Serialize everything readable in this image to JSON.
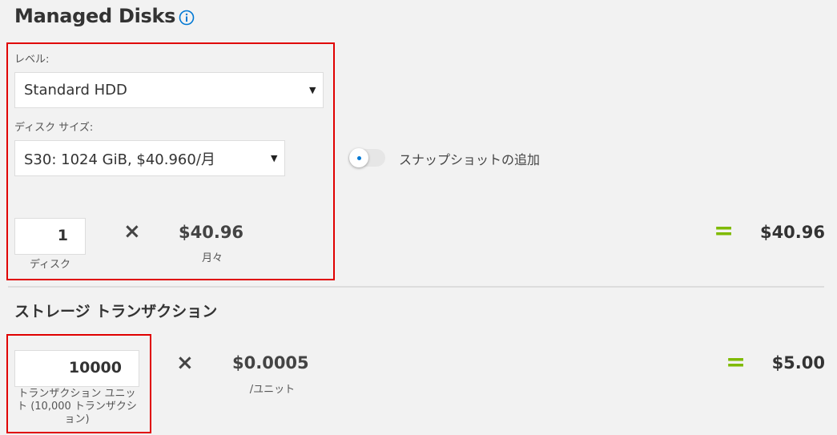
{
  "managed_disks": {
    "title": "Managed Disks",
    "info_icon": "info-circle-icon",
    "tier": {
      "label": "レベル:",
      "value": "Standard HDD"
    },
    "disk_size": {
      "label": "ディスク サイズ:",
      "value": "S30: 1024 GiB, $40.960/月"
    },
    "snapshot_toggle": {
      "label": "スナップショットの追加",
      "on": false
    },
    "quantity": {
      "value": "1",
      "unit_label": "ディスク"
    },
    "multiply_icon": "×",
    "price": {
      "value": "$40.96",
      "unit": "月々"
    },
    "equals_icon": "=",
    "total": "$40.96"
  },
  "storage_transactions": {
    "title": "ストレージ トランザクション",
    "quantity": {
      "value": "10000",
      "unit_label": "トランザクション ユニット (10,000 トランザクション)"
    },
    "multiply_icon": "×",
    "price": {
      "value": "$0.0005",
      "unit": "/ユニット"
    },
    "equals_icon": "=",
    "total": "$5.00"
  },
  "colors": {
    "highlight": "#e00000",
    "accent": "#7fba00",
    "info": "#0078d4"
  }
}
